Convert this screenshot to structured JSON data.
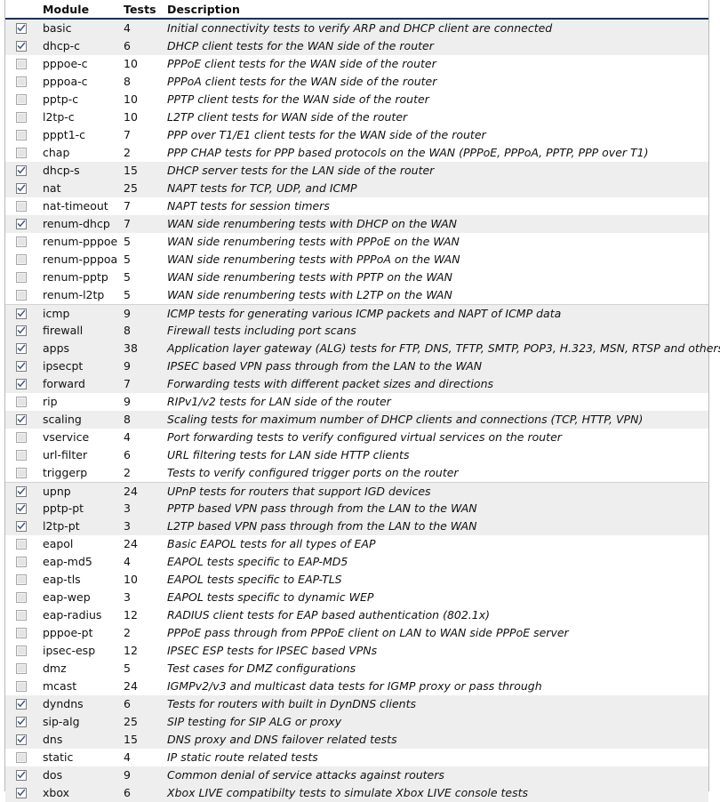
{
  "table": {
    "columns": {
      "select": "",
      "module": "Module",
      "tests": "Tests",
      "description": "Description"
    },
    "colors": {
      "header_rule": "#16325c",
      "row_highlight": "#eeeeee",
      "frame_border": "#b9b9b9",
      "group_separator": "#d2d2d2",
      "checkmark": "#41577a"
    },
    "rows": [
      {
        "checked": true,
        "group_start": false,
        "module": "basic",
        "tests": "4",
        "description": "Initial connectivity tests to verify ARP and DHCP client are connected"
      },
      {
        "checked": true,
        "group_start": false,
        "module": "dhcp-c",
        "tests": "6",
        "description": "DHCP client tests for the WAN side of the router"
      },
      {
        "checked": false,
        "group_start": false,
        "module": "pppoe-c",
        "tests": "10",
        "description": "PPPoE client tests for the WAN side of the router"
      },
      {
        "checked": false,
        "group_start": false,
        "module": "pppoa-c",
        "tests": "8",
        "description": "PPPoA client tests for the WAN side of the router"
      },
      {
        "checked": false,
        "group_start": false,
        "module": "pptp-c",
        "tests": "10",
        "description": "PPTP client tests for the WAN side of the router"
      },
      {
        "checked": false,
        "group_start": false,
        "module": "l2tp-c",
        "tests": "10",
        "description": "L2TP client tests for WAN side of the router"
      },
      {
        "checked": false,
        "group_start": false,
        "module": "pppt1-c",
        "tests": "7",
        "description": "PPP over T1/E1 client tests for the WAN side of the router"
      },
      {
        "checked": false,
        "group_start": false,
        "module": "chap",
        "tests": "2",
        "description": "PPP CHAP tests for PPP based protocols on the WAN (PPPoE, PPPoA, PPTP, PPP over T1)"
      },
      {
        "checked": true,
        "group_start": false,
        "module": "dhcp-s",
        "tests": "15",
        "description": "DHCP server tests for the LAN side of the router"
      },
      {
        "checked": true,
        "group_start": false,
        "module": "nat",
        "tests": "25",
        "description": "NAPT tests for TCP, UDP, and ICMP"
      },
      {
        "checked": false,
        "group_start": false,
        "module": "nat-timeout",
        "tests": "7",
        "description": "NAPT tests for session timers"
      },
      {
        "checked": true,
        "group_start": false,
        "module": "renum-dhcp",
        "tests": "7",
        "description": "WAN side renumbering tests with DHCP on the WAN"
      },
      {
        "checked": false,
        "group_start": false,
        "module": "renum-pppoe",
        "tests": "5",
        "description": "WAN side renumbering tests with PPPoE on the WAN"
      },
      {
        "checked": false,
        "group_start": false,
        "module": "renum-pppoa",
        "tests": "5",
        "description": "WAN side renumbering tests with PPPoA on the WAN"
      },
      {
        "checked": false,
        "group_start": false,
        "module": "renum-pptp",
        "tests": "5",
        "description": "WAN side renumbering tests with PPTP on the WAN"
      },
      {
        "checked": false,
        "group_start": false,
        "module": "renum-l2tp",
        "tests": "5",
        "description": "WAN side renumbering tests with L2TP on the WAN"
      },
      {
        "checked": true,
        "group_start": true,
        "module": "icmp",
        "tests": "9",
        "description": "ICMP tests for generating various ICMP packets and NAPT of ICMP data"
      },
      {
        "checked": true,
        "group_start": false,
        "module": "firewall",
        "tests": "8",
        "description": "Firewall tests including port scans"
      },
      {
        "checked": true,
        "group_start": false,
        "module": "apps",
        "tests": "38",
        "description": "Application layer gateway (ALG) tests for FTP, DNS, TFTP, SMTP, POP3, H.323, MSN, RTSP and others"
      },
      {
        "checked": true,
        "group_start": false,
        "module": "ipsecpt",
        "tests": "9",
        "description": "IPSEC based VPN pass through from the LAN to the WAN"
      },
      {
        "checked": true,
        "group_start": false,
        "module": "forward",
        "tests": "7",
        "description": "Forwarding tests with different packet sizes and directions"
      },
      {
        "checked": false,
        "group_start": false,
        "module": "rip",
        "tests": "9",
        "description": "RIPv1/v2 tests for LAN side of the router"
      },
      {
        "checked": true,
        "group_start": false,
        "module": "scaling",
        "tests": "8",
        "description": "Scaling tests for maximum number of DHCP clients and connections (TCP, HTTP, VPN)"
      },
      {
        "checked": false,
        "group_start": false,
        "module": "vservice",
        "tests": "4",
        "description": "Port forwarding tests to verify configured virtual services on the router"
      },
      {
        "checked": false,
        "group_start": false,
        "module": "url-filter",
        "tests": "6",
        "description": "URL filtering tests for LAN side HTTP clients"
      },
      {
        "checked": false,
        "group_start": false,
        "module": "triggerp",
        "tests": "2",
        "description": "Tests to verify configured trigger ports on the router"
      },
      {
        "checked": true,
        "group_start": true,
        "module": "upnp",
        "tests": "24",
        "description": "UPnP tests for routers that support IGD devices"
      },
      {
        "checked": true,
        "group_start": false,
        "module": "pptp-pt",
        "tests": "3",
        "description": "PPTP based VPN pass through from the LAN to the WAN"
      },
      {
        "checked": true,
        "group_start": false,
        "module": "l2tp-pt",
        "tests": "3",
        "description": "L2TP based VPN pass through from the LAN to the WAN"
      },
      {
        "checked": false,
        "group_start": false,
        "module": "eapol",
        "tests": "24",
        "description": "Basic EAPOL tests for all types of EAP"
      },
      {
        "checked": false,
        "group_start": false,
        "module": "eap-md5",
        "tests": "4",
        "description": "EAPOL tests specific to EAP-MD5"
      },
      {
        "checked": false,
        "group_start": false,
        "module": "eap-tls",
        "tests": "10",
        "description": "EAPOL tests specific to EAP-TLS"
      },
      {
        "checked": false,
        "group_start": false,
        "module": "eap-wep",
        "tests": "3",
        "description": "EAPOL tests specific to dynamic WEP"
      },
      {
        "checked": false,
        "group_start": false,
        "module": "eap-radius",
        "tests": "12",
        "description": "RADIUS client tests for EAP based authentication (802.1x)"
      },
      {
        "checked": false,
        "group_start": false,
        "module": "pppoe-pt",
        "tests": "2",
        "description": "PPPoE pass through from PPPoE client on LAN to WAN side PPPoE server"
      },
      {
        "checked": false,
        "group_start": false,
        "module": "ipsec-esp",
        "tests": "12",
        "description": "IPSEC ESP tests for IPSEC based VPNs"
      },
      {
        "checked": false,
        "group_start": false,
        "module": "dmz",
        "tests": "5",
        "description": "Test cases for DMZ configurations"
      },
      {
        "checked": false,
        "group_start": false,
        "module": "mcast",
        "tests": "24",
        "description": "IGMPv2/v3 and multicast data tests for IGMP proxy or pass through"
      },
      {
        "checked": true,
        "group_start": false,
        "module": "dyndns",
        "tests": "6",
        "description": "Tests for routers with built in DynDNS clients"
      },
      {
        "checked": true,
        "group_start": false,
        "module": "sip-alg",
        "tests": "25",
        "description": "SIP testing for SIP ALG or proxy"
      },
      {
        "checked": true,
        "group_start": false,
        "module": "dns",
        "tests": "15",
        "description": "DNS proxy and DNS failover related tests"
      },
      {
        "checked": false,
        "group_start": false,
        "module": "static",
        "tests": "4",
        "description": "IP static route related tests"
      },
      {
        "checked": true,
        "group_start": false,
        "module": "dos",
        "tests": "9",
        "description": "Common denial of service attacks against routers"
      },
      {
        "checked": true,
        "group_start": false,
        "module": "xbox",
        "tests": "6",
        "description": "Xbox LIVE compatibilty tests to simulate Xbox LIVE console tests"
      }
    ]
  }
}
